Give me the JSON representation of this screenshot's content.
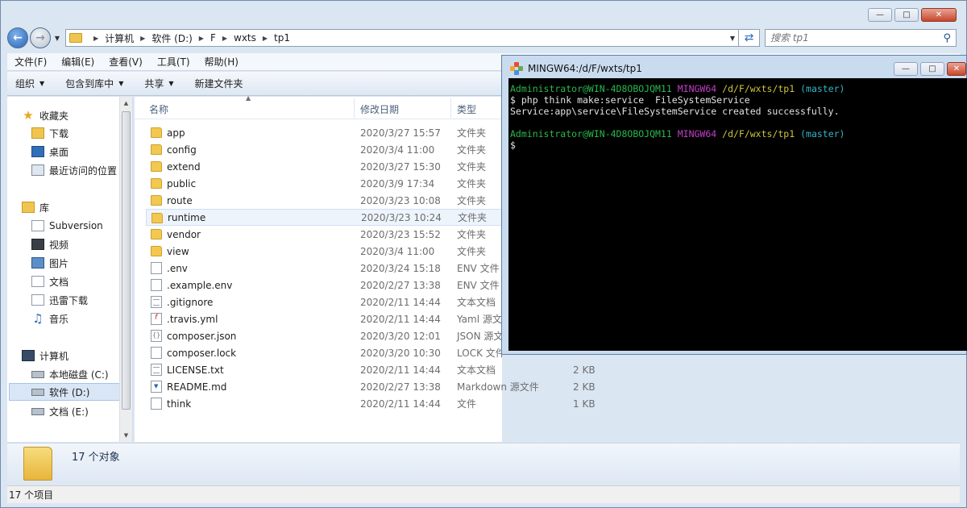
{
  "explorer": {
    "breadcrumb": [
      "计算机",
      "软件 (D:)",
      "F",
      "wxts",
      "tp1"
    ],
    "search_placeholder": "搜索 tp1",
    "menu": [
      "文件(F)",
      "编辑(E)",
      "查看(V)",
      "工具(T)",
      "帮助(H)"
    ],
    "commands": {
      "organize": "组织",
      "include_library": "包含到库中",
      "share": "共享",
      "new_folder": "新建文件夹"
    },
    "nav": {
      "favorites": "收藏夹",
      "downloads": "下载",
      "desktop": "桌面",
      "recent": "最近访问的位置",
      "libraries": "库",
      "subversion": "Subversion",
      "videos": "视频",
      "pictures": "图片",
      "documents": "文档",
      "xunlei": "迅雷下载",
      "music": "音乐",
      "computer": "计算机",
      "drive_c": "本地磁盘 (C:)",
      "drive_d": "软件 (D:)",
      "drive_e": "文档 (E:)"
    },
    "columns": {
      "name": "名称",
      "date": "修改日期",
      "type": "类型"
    },
    "files": [
      {
        "name": "app",
        "date": "2020/3/27 15:57",
        "type": "文件夹",
        "size": "",
        "icon": "folder"
      },
      {
        "name": "config",
        "date": "2020/3/4 11:00",
        "type": "文件夹",
        "size": "",
        "icon": "folder"
      },
      {
        "name": "extend",
        "date": "2020/3/27 15:30",
        "type": "文件夹",
        "size": "",
        "icon": "folder"
      },
      {
        "name": "public",
        "date": "2020/3/9 17:34",
        "type": "文件夹",
        "size": "",
        "icon": "folder"
      },
      {
        "name": "route",
        "date": "2020/3/23 10:08",
        "type": "文件夹",
        "size": "",
        "icon": "folder"
      },
      {
        "name": "runtime",
        "date": "2020/3/23 10:24",
        "type": "文件夹",
        "size": "",
        "icon": "folder"
      },
      {
        "name": "vendor",
        "date": "2020/3/23 15:52",
        "type": "文件夹",
        "size": "",
        "icon": "folder"
      },
      {
        "name": "view",
        "date": "2020/3/4 11:00",
        "type": "文件夹",
        "size": "",
        "icon": "folder"
      },
      {
        "name": ".env",
        "date": "2020/3/24 15:18",
        "type": "ENV 文件",
        "size": "",
        "icon": "file"
      },
      {
        "name": ".example.env",
        "date": "2020/2/27 13:38",
        "type": "ENV 文件",
        "size": "",
        "icon": "file"
      },
      {
        "name": ".gitignore",
        "date": "2020/2/11 14:44",
        "type": "文本文档",
        "size": "",
        "icon": "text"
      },
      {
        "name": ".travis.yml",
        "date": "2020/2/11 14:44",
        "type": "Yaml 源文",
        "size": "",
        "icon": "yaml"
      },
      {
        "name": "composer.json",
        "date": "2020/3/20 12:01",
        "type": "JSON 源文",
        "size": "",
        "icon": "json"
      },
      {
        "name": "composer.lock",
        "date": "2020/3/20 10:30",
        "type": "LOCK 文件",
        "size": "",
        "icon": "file"
      },
      {
        "name": "LICENSE.txt",
        "date": "2020/2/11 14:44",
        "type": "文本文档",
        "size": "2 KB",
        "icon": "text"
      },
      {
        "name": "README.md",
        "date": "2020/2/27 13:38",
        "type": "Markdown 源文件",
        "size": "2 KB",
        "icon": "md"
      },
      {
        "name": "think",
        "date": "2020/2/11 14:44",
        "type": "文件",
        "size": "1 KB",
        "icon": "file"
      }
    ],
    "details_count": "17 个对象",
    "status": "17 个项目"
  },
  "terminal": {
    "title": "MINGW64:/d/F/wxts/tp1",
    "prompt_user": "Administrator@WIN-4D8OBOJQM11",
    "prompt_env": "MINGW64",
    "prompt_path": "/d/F/wxts/tp1",
    "prompt_branch": "(master)",
    "command": "$ php think make:service  FileSystemService",
    "output": "Service:app\\service\\FileSystemService created successfully.",
    "cursor_prompt": "$"
  }
}
